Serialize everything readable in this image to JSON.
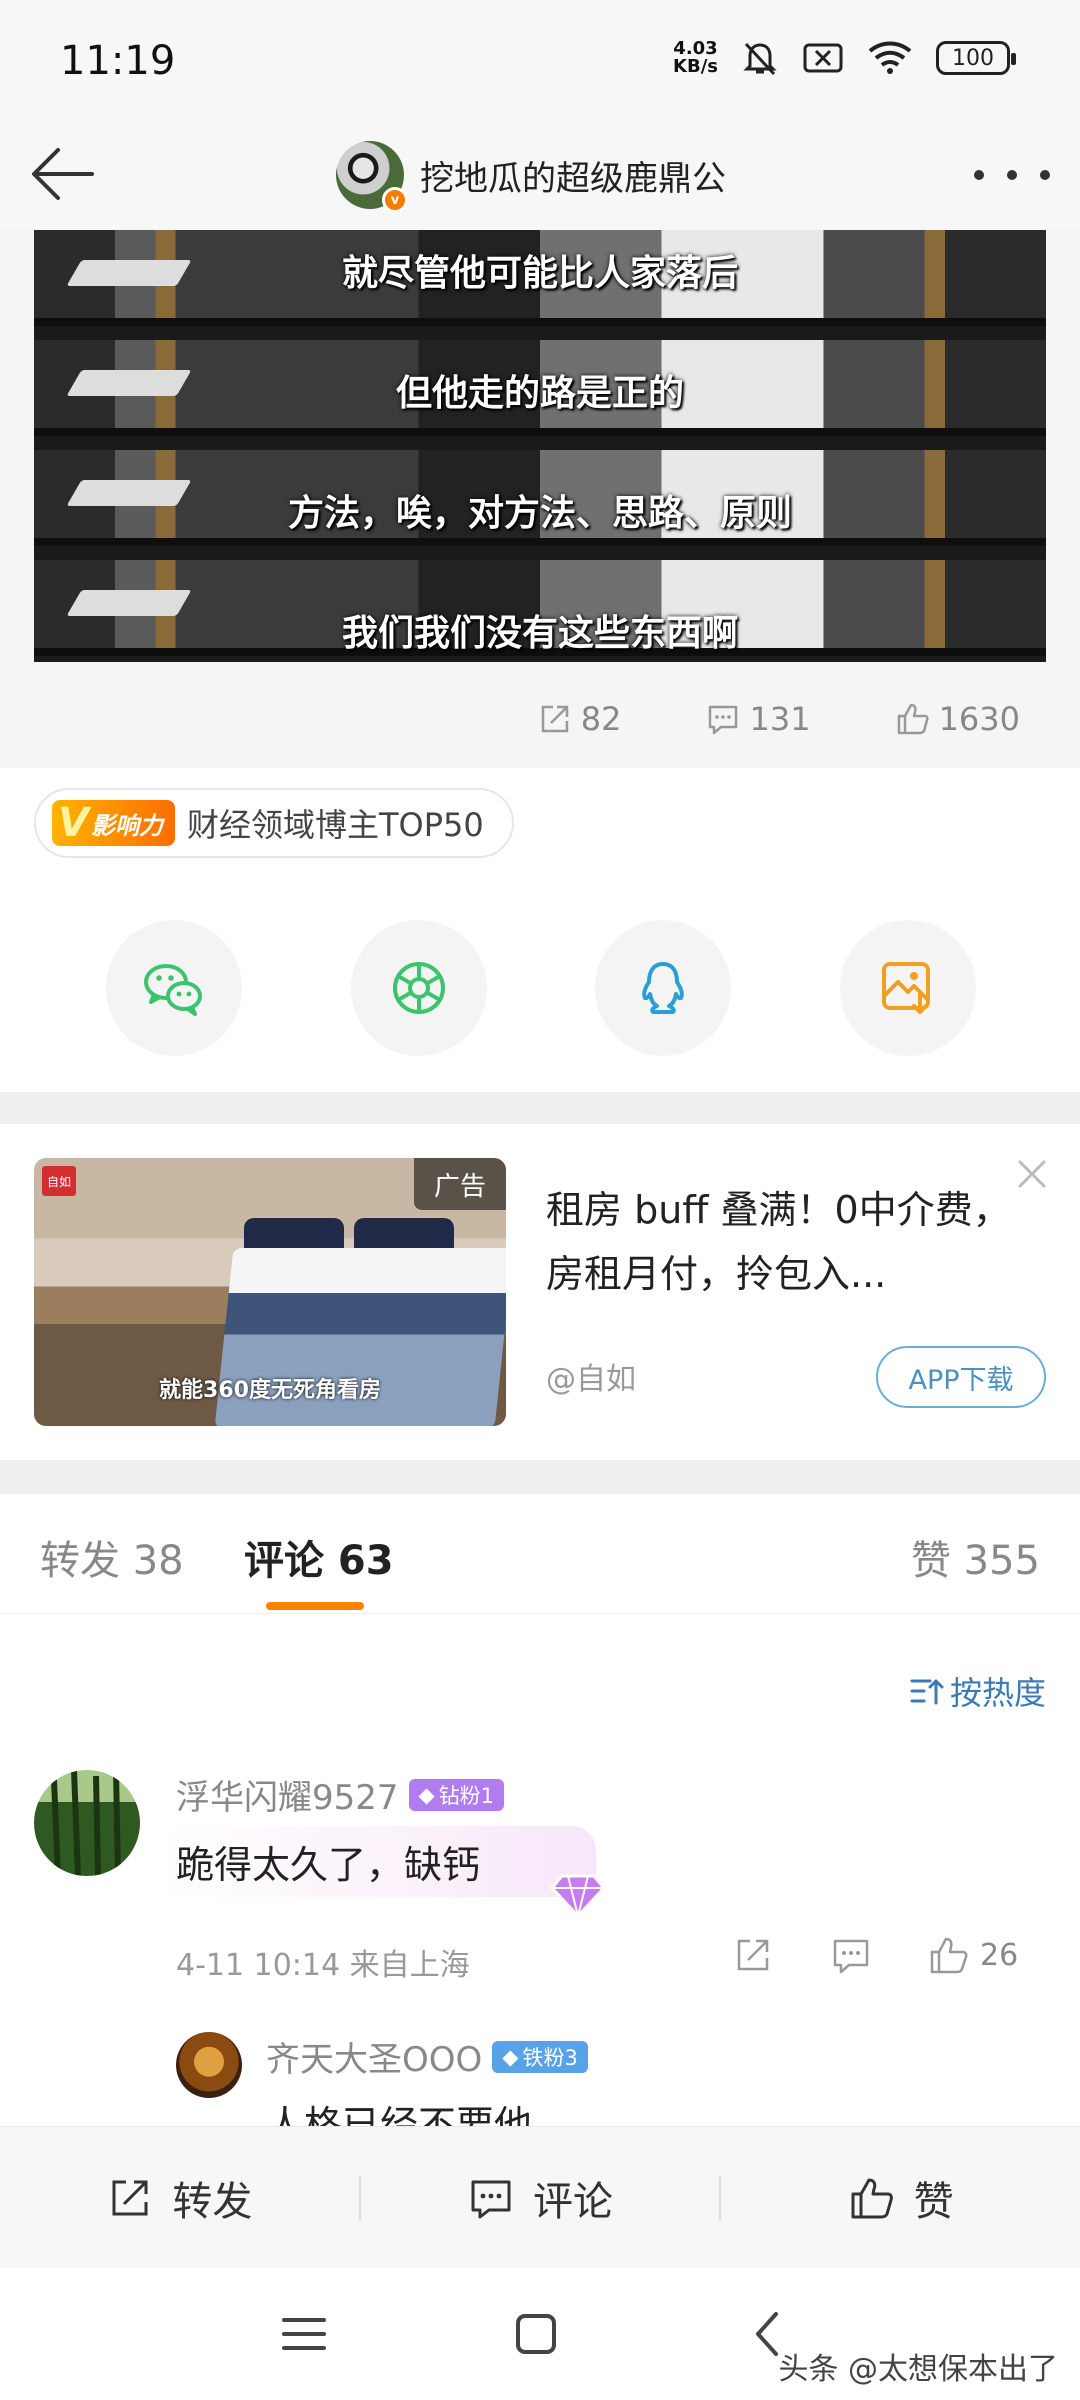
{
  "status_bar": {
    "time": "11:19",
    "net_speed_value": "4.03",
    "net_speed_unit": "KB/s",
    "battery": "100"
  },
  "header": {
    "title": "挖地瓜的超级鹿鼎公",
    "verified_mark": "v"
  },
  "video": {
    "captions": [
      "就尽管他可能比人家落后",
      "但他走的路是正的",
      "方法，唉，对方法、思路、原则",
      "我们我们没有这些东西啊"
    ]
  },
  "post_stats": {
    "reposts": "82",
    "comments": "131",
    "likes": "1630"
  },
  "influence": {
    "logo_v": "V",
    "logo_text": "影响力",
    "label": "财经领域博主TOP50"
  },
  "share_targets": [
    "wechat-icon",
    "moments-icon",
    "qq-icon",
    "save-image-icon"
  ],
  "ad": {
    "tag": "广告",
    "brand_logo": "自如",
    "image_caption": "就能360度无死角看房",
    "title": "租房 buff 叠满！0中介费，房租月付，拎包入...",
    "source": "@自如",
    "download_label": "APP下载"
  },
  "tabs": {
    "repost": "转发 38",
    "comment": "评论 63",
    "like": "赞 355"
  },
  "sort_label": "按热度",
  "comments": [
    {
      "username": "浮华闪耀9527",
      "badge": "钻粉1",
      "badge_color": "#b07cf0",
      "text": "跪得太久了，缺钙",
      "time_location": "4-11 10:14  来自上海",
      "likes": "26"
    },
    {
      "username": "齐天大圣OOO",
      "badge": "铁粉3",
      "badge_color": "#5aa2e8",
      "text": "人格已经不要他"
    }
  ],
  "action_bar": {
    "repost": "转发",
    "comment": "评论",
    "like": "赞"
  },
  "watermark": "头条 @太想保本出了",
  "colors": {
    "accent_orange": "#ff8200",
    "link_blue": "#3a7bb5"
  }
}
